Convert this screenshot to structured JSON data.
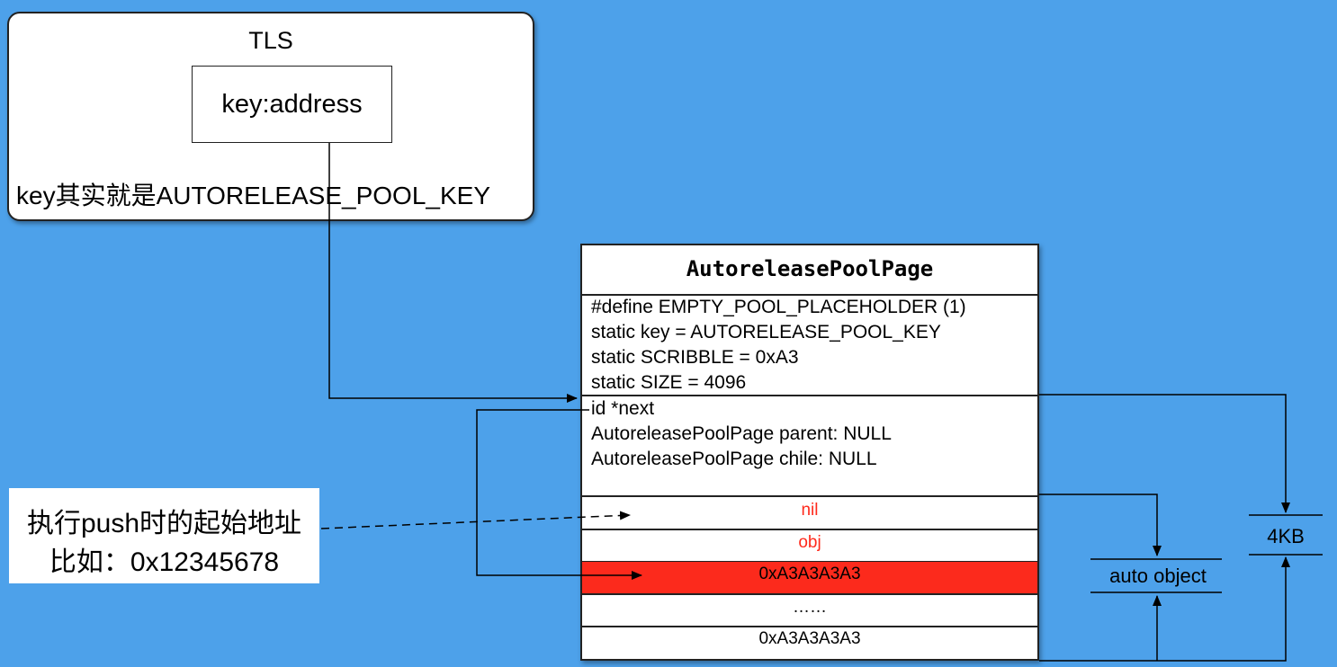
{
  "tls": {
    "title": "TLS",
    "key_label": "key:address",
    "note": "key其实就是AUTORELEASE_POOL_KEY"
  },
  "page": {
    "title": "AutoreleasePoolPage",
    "defines": [
      "#define EMPTY_POOL_PLACEHOLDER (1)",
      "static key = AUTORELEASE_POOL_KEY",
      "static SCRIBBLE = 0xA3",
      "static SIZE = 4096"
    ],
    "fields": [
      "id *next",
      "AutoreleasePoolPage parent: NULL",
      "AutoreleasePoolPage chile: NULL"
    ],
    "cells": [
      "nil",
      "obj",
      "0xA3A3A3A3",
      "……",
      "0xA3A3A3A3"
    ]
  },
  "push_note": {
    "line1": "执行push时的起始地址",
    "line2": "比如：0x12345678"
  },
  "labels": {
    "auto_object": "auto object",
    "size": "4KB"
  },
  "colors": {
    "background": "#4da1ea",
    "highlight_row": "#fc2a1c",
    "highlight_text": "#ff2a1c"
  }
}
